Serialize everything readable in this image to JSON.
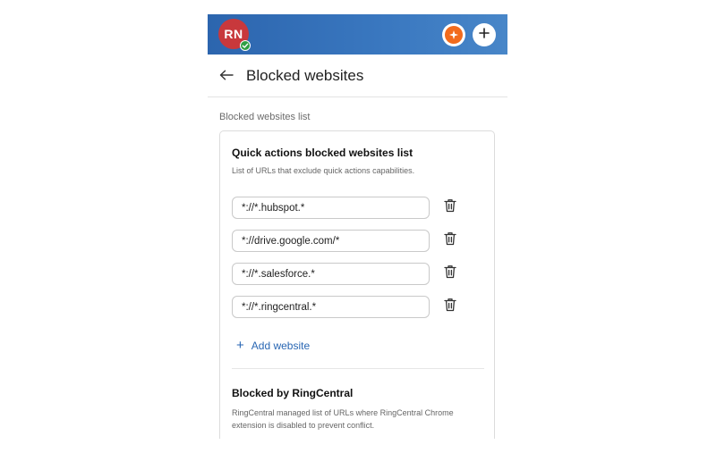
{
  "topbar": {
    "avatar_initials": "RN",
    "presence_icon": "check-icon",
    "ai_icon": "sparkle-icon",
    "add_icon": "plus-icon",
    "colors": {
      "bar_start": "#2c65ae",
      "bar_end": "#4886c8",
      "avatar": "#c8383c",
      "presence": "#2f9e44",
      "ai": "#f26b1d"
    }
  },
  "header": {
    "back_icon": "arrow-left-icon",
    "title": "Blocked websites"
  },
  "section_label": "Blocked websites list",
  "quick_actions": {
    "title": "Quick actions blocked websites list",
    "description": "List of URLs that exclude quick actions capabilities.",
    "urls": [
      "*://*.hubspot.*",
      "*://drive.google.com/*",
      "*://*.salesforce.*",
      "*://*.ringcentral.*"
    ],
    "delete_icon": "trash-icon",
    "add_label": "Add website",
    "accent": "#2866b3"
  },
  "blocked_by_ringcentral": {
    "title": "Blocked by RingCentral",
    "description": "RingCentral managed list of URLs where RingCentral Chrome extension is disabled to prevent conflict."
  }
}
